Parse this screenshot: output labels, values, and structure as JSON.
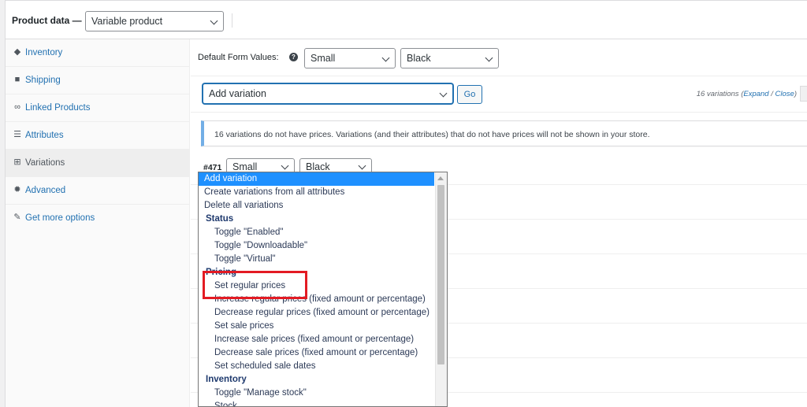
{
  "header": {
    "label": "Product data —",
    "product_type": "Variable product"
  },
  "sidebar": {
    "items": [
      {
        "label": "Inventory",
        "icon": "tag-icon"
      },
      {
        "label": "Shipping",
        "icon": "truck-icon"
      },
      {
        "label": "Linked Products",
        "icon": "link-icon"
      },
      {
        "label": "Attributes",
        "icon": "list-icon"
      },
      {
        "label": "Variations",
        "icon": "grid-icon"
      },
      {
        "label": "Advanced",
        "icon": "gear-icon"
      },
      {
        "label": "Get more options",
        "icon": "plug-icon"
      }
    ],
    "active": "Variations"
  },
  "defaults": {
    "label": "Default Form Values:",
    "size": "Small",
    "color": "Black"
  },
  "bulk": {
    "action": "Add variation",
    "go_label": "Go",
    "count_prefix": "16 variations",
    "expand": "Expand",
    "close": "Close"
  },
  "notice": "16 variations do not have prices. Variations (and their attributes) that do not have prices will not be shown in your store.",
  "variation": {
    "id": "#471",
    "size": "Small",
    "color": "Black"
  },
  "dropdown": {
    "selected": "Add variation",
    "options": [
      {
        "label": "Add variation",
        "kind": "top"
      },
      {
        "label": "Create variations from all attributes",
        "kind": "top"
      },
      {
        "label": "Delete all variations",
        "kind": "top"
      },
      {
        "label": "Status",
        "kind": "group"
      },
      {
        "label": "Toggle \"Enabled\"",
        "kind": "sub"
      },
      {
        "label": "Toggle \"Downloadable\"",
        "kind": "sub"
      },
      {
        "label": "Toggle \"Virtual\"",
        "kind": "sub"
      },
      {
        "label": "Pricing",
        "kind": "group"
      },
      {
        "label": "Set regular prices",
        "kind": "sub"
      },
      {
        "label": "Increase regular prices (fixed amount or percentage)",
        "kind": "sub"
      },
      {
        "label": "Decrease regular prices (fixed amount or percentage)",
        "kind": "sub"
      },
      {
        "label": "Set sale prices",
        "kind": "sub"
      },
      {
        "label": "Increase sale prices (fixed amount or percentage)",
        "kind": "sub"
      },
      {
        "label": "Decrease sale prices (fixed amount or percentage)",
        "kind": "sub"
      },
      {
        "label": "Set scheduled sale dates",
        "kind": "sub"
      },
      {
        "label": "Inventory",
        "kind": "group"
      },
      {
        "label": "Toggle \"Manage stock\"",
        "kind": "sub"
      },
      {
        "label": "Stock",
        "kind": "sub"
      }
    ]
  },
  "colors": {
    "link": "#2271b1",
    "selected_option": "#1e90ff",
    "highlight": "#e31b23",
    "notice_border": "#72aee6"
  }
}
